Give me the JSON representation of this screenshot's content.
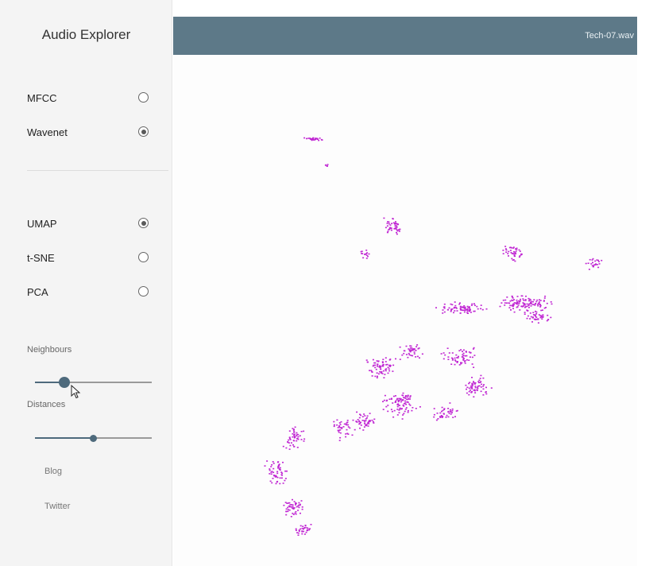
{
  "app": {
    "title": "Audio Explorer"
  },
  "features": [
    {
      "label": "MFCC",
      "selected": false
    },
    {
      "label": "Wavenet",
      "selected": true
    }
  ],
  "reductions": [
    {
      "label": "UMAP",
      "selected": true
    },
    {
      "label": "t-SNE",
      "selected": false
    },
    {
      "label": "PCA",
      "selected": false
    }
  ],
  "sliders": {
    "neighbours": {
      "label": "Neighbours",
      "fraction": 0.25
    },
    "distances": {
      "label": "Distances",
      "fraction": 0.5
    }
  },
  "links": {
    "blog": "Blog",
    "twitter": "Twitter"
  },
  "header": {
    "filename": "Tech-07.wav"
  },
  "scatter": {
    "point_color": "#c026d3"
  },
  "colors": {
    "topbar": "#5d7988",
    "accent": "#4e6a7c"
  }
}
